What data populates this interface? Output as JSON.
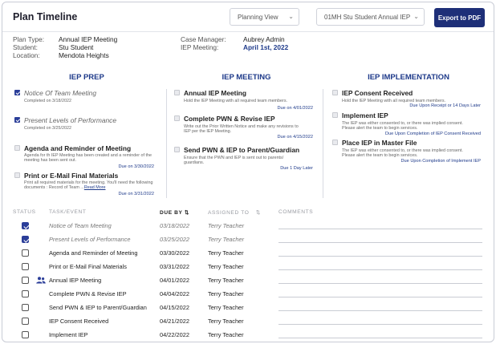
{
  "header": {
    "title": "Plan Timeline",
    "plan_view": "Planning View",
    "student_select": "01MH Stu Student Annual IEP",
    "export_label": "Export to PDF"
  },
  "info": {
    "plan_type_label": "Plan Type:",
    "plan_type": "Annual IEP Meeting",
    "student_label": "Student:",
    "student": "Stu Student",
    "location_label": "Location:",
    "location": "Mendota Heights",
    "case_manager_label": "Case Manager:",
    "case_manager": "Aubrey Admin",
    "iep_meeting_label": "IEP Meeting:",
    "iep_meeting": "April 1st, 2022"
  },
  "columns": [
    {
      "title": "IEP PREP",
      "cards": [
        {
          "title": "Notice Of Team Meeting",
          "done": true,
          "desc": "Completed on 3/18/2022",
          "due": ""
        },
        {
          "title": "Present Levels of Performance",
          "done": true,
          "desc": "Completed on 3/25/2022",
          "due": ""
        },
        {
          "title": "Agenda and Reminder of Meeting",
          "done": false,
          "desc": "Agenda for th IEP Meeting has been created and a reminder of the meeting has been sent out.",
          "due": "Due on 3/30/2022"
        },
        {
          "title": "Print or E-Mail Final Materials",
          "done": false,
          "desc": "Print all required materials for the meeting. You'll need the following documents : Record of Team ...",
          "more": "Read More",
          "due": "Due on 3/31/2022"
        }
      ]
    },
    {
      "title": "IEP MEETING",
      "cards": [
        {
          "title": "Annual IEP Meeting",
          "done": false,
          "desc": "Hold the IEP Meeting with all required team members.",
          "due": "Due on 4/01/2022"
        },
        {
          "title": "Complete PWN & Revise IEP",
          "done": false,
          "desc": "Write out the Prior Written Notice and make any revisions to IEP per the IEP Meeting.",
          "due": "Due on 4/15/2022"
        },
        {
          "title": "Send PWN & IEP to Parent/Guardian",
          "done": false,
          "desc": "Ensure that the PWN and IEP is sent out to parents/ guardians.",
          "due": "Due 1 Day Later"
        }
      ]
    },
    {
      "title": "IEP IMPLEMENTATION",
      "cards": [
        {
          "title": "IEP Consent Received",
          "done": false,
          "desc": "Hold the IEP Meeting with all required team members.",
          "due": "Due Upon Receipt or 14 Days Later"
        },
        {
          "title": "Implement IEP",
          "done": false,
          "desc": "The IEP was either consented to, or there was implied consent. Please alert the team to begin services.",
          "due": "Due Upon Completion of IEP Consent Received"
        },
        {
          "title": "Place IEP in Master File",
          "done": false,
          "desc": "The IEP was either consented to, or there was implied consent. Please alert the team to begin services.",
          "due": "Due Upon Completion of Implement IEP"
        }
      ]
    }
  ],
  "table": {
    "headers": {
      "status": "STATUS",
      "task": "TASK/EVENT",
      "due_by": "DUE BY",
      "assigned_to": "ASSIGNED TO",
      "comments": "COMMENTS"
    },
    "rows": [
      {
        "done": true,
        "task": "Notice of Team Meeting",
        "due": "03/18/2022",
        "assigned": "Terry Teacher",
        "icon": ""
      },
      {
        "done": true,
        "task": "Present Levels of Performance",
        "due": "03/25/2022",
        "assigned": "Terry Teacher",
        "icon": ""
      },
      {
        "done": false,
        "task": "Agenda and Reminder of Meeting",
        "due": "03/30/2022",
        "assigned": "Terry Teacher",
        "icon": ""
      },
      {
        "done": false,
        "task": "Print or E-Mail Final Materials",
        "due": "03/31/2022",
        "assigned": "Terry Teacher",
        "icon": ""
      },
      {
        "done": false,
        "task": "Annual IEP Meeting",
        "due": "04/01/2022",
        "assigned": "Terry Teacher",
        "icon": "people-icon"
      },
      {
        "done": false,
        "task": "Complete PWN & Revise IEP",
        "due": "04/04/2022",
        "assigned": "Terry Teacher",
        "icon": ""
      },
      {
        "done": false,
        "task": "Send PWN & IEP to Parent/Guardian",
        "due": "04/15/2022",
        "assigned": "Terry Teacher",
        "icon": ""
      },
      {
        "done": false,
        "task": "IEP Consent Received",
        "due": "04/21/2022",
        "assigned": "Terry Teacher",
        "icon": ""
      },
      {
        "done": false,
        "task": "Implement IEP",
        "due": "04/22/2022",
        "assigned": "Terry Teacher",
        "icon": ""
      }
    ]
  },
  "colors": {
    "accent": "#1e2f78",
    "link": "#1e3a8a",
    "checked": "#2b3e99"
  }
}
